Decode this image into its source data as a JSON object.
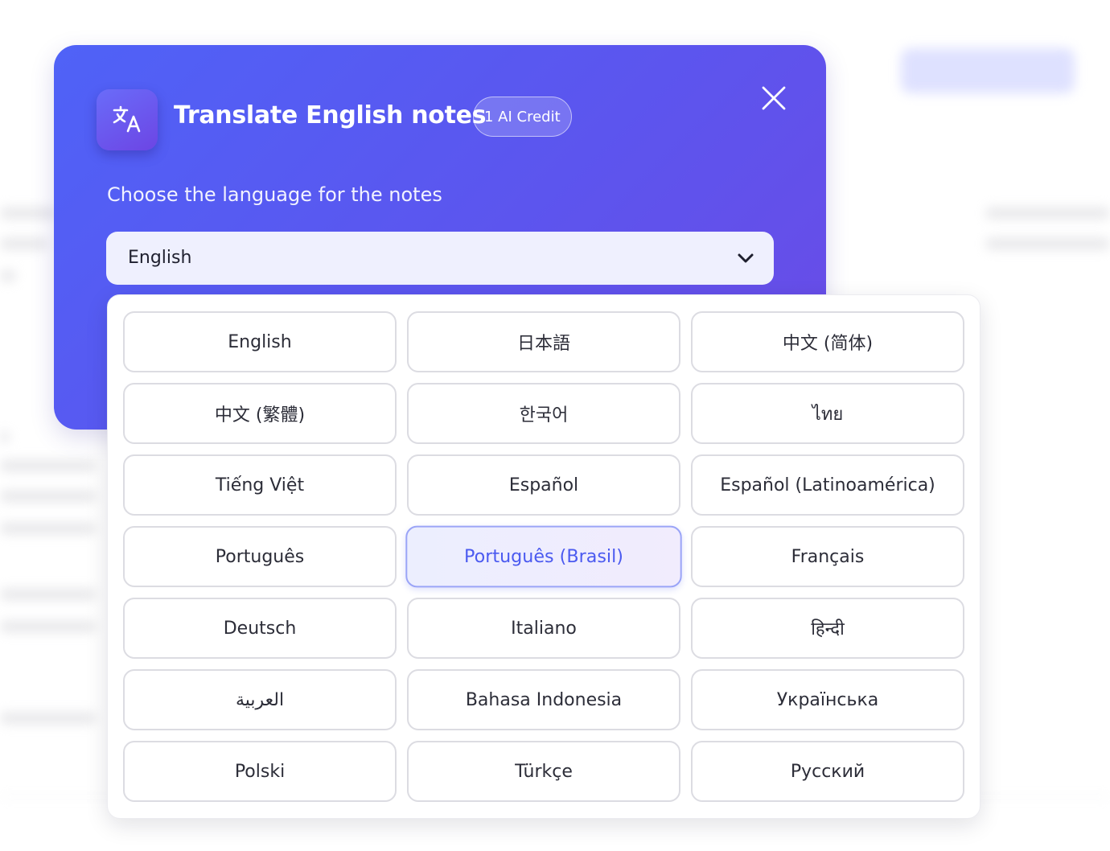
{
  "modal": {
    "title": "Translate English notes",
    "credit_badge": "1 AI Credit",
    "subtitle": "Choose the language for the notes",
    "icon": "translate-icon",
    "close_icon": "close-icon"
  },
  "select": {
    "value": "English",
    "icon": "chevron-down-icon"
  },
  "languages": [
    {
      "label": "English",
      "selected": false
    },
    {
      "label": "日本語",
      "selected": false
    },
    {
      "label": "中文 (简体)",
      "selected": false
    },
    {
      "label": "中文 (繁體)",
      "selected": false
    },
    {
      "label": "한국어",
      "selected": false
    },
    {
      "label": "ไทย",
      "selected": false
    },
    {
      "label": "Tiếng Việt",
      "selected": false
    },
    {
      "label": "Español",
      "selected": false
    },
    {
      "label": "Español (Latinoamérica)",
      "selected": false
    },
    {
      "label": "Português",
      "selected": false
    },
    {
      "label": "Português (Brasil)",
      "selected": true
    },
    {
      "label": "Français",
      "selected": false
    },
    {
      "label": "Deutsch",
      "selected": false
    },
    {
      "label": "Italiano",
      "selected": false
    },
    {
      "label": "हिन्दी",
      "selected": false
    },
    {
      "label": "العربية",
      "selected": false
    },
    {
      "label": "Bahasa Indonesia",
      "selected": false
    },
    {
      "label": "Українська",
      "selected": false
    },
    {
      "label": "Polski",
      "selected": false
    },
    {
      "label": "Türkçe",
      "selected": false
    },
    {
      "label": "Русский",
      "selected": false
    }
  ],
  "colors": {
    "accent": "#4b5af0",
    "modal_gradient_start": "#4f62f7",
    "modal_gradient_end": "#6a4be6"
  }
}
